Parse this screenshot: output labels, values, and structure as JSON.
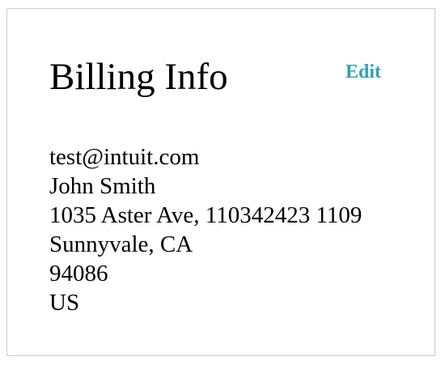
{
  "billing": {
    "title": "Billing Info",
    "edit_label": "Edit",
    "email": "test@intuit.com",
    "name": "John Smith",
    "address_line": "1035 Aster Ave, 110342423 1109",
    "city_state": "Sunnyvale, CA",
    "zip": "94086",
    "country": "US"
  },
  "colors": {
    "edit_link": "#2ea3b5",
    "border": "#cccccc",
    "text": "#000000"
  }
}
